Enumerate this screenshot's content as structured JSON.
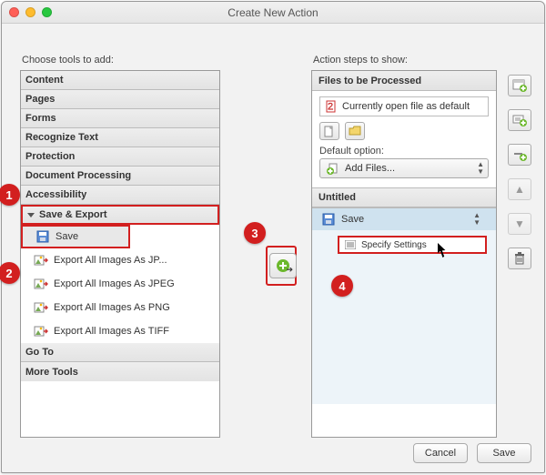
{
  "title": "Create New Action",
  "left": {
    "heading": "Choose tools to add:",
    "sections": [
      {
        "label": "Content",
        "open": false
      },
      {
        "label": "Pages",
        "open": false
      },
      {
        "label": "Forms",
        "open": false
      },
      {
        "label": "Recognize Text",
        "open": false
      },
      {
        "label": "Protection",
        "open": false
      },
      {
        "label": "Document Processing",
        "open": false
      },
      {
        "label": "Accessibility",
        "open": false
      },
      {
        "label": "Save & Export",
        "open": true,
        "items": [
          {
            "label": "Save",
            "selected": true,
            "icon": "floppy"
          },
          {
            "label": "Export All Images As JP...",
            "icon": "export-img"
          },
          {
            "label": "Export All Images As JPEG",
            "icon": "export-img"
          },
          {
            "label": "Export All Images As PNG",
            "icon": "export-img"
          },
          {
            "label": "Export All Images As TIFF",
            "icon": "export-img"
          }
        ]
      },
      {
        "label": "Go To",
        "open": false
      },
      {
        "label": "More Tools",
        "open": false
      }
    ]
  },
  "mid": {
    "tooltip": "Add"
  },
  "right": {
    "heading": "Action steps to show:",
    "files_header": "Files to be Processed",
    "current_file": "Currently open file as default",
    "default_label": "Default option:",
    "default_dropdown": {
      "icon": "plus-file",
      "label": "Add Files..."
    },
    "untitled_header": "Untitled",
    "step": {
      "icon": "floppy",
      "label": "Save"
    },
    "specify": "Specify Settings"
  },
  "buttons": {
    "cancel": "Cancel",
    "save": "Save"
  },
  "annotations": [
    "1",
    "2",
    "3",
    "4"
  ]
}
